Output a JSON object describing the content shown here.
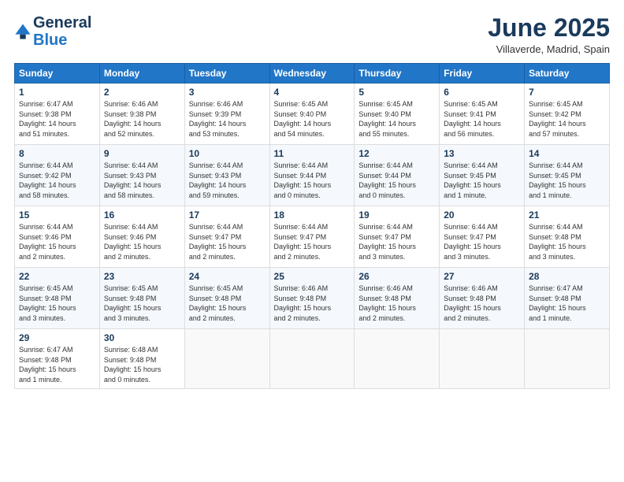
{
  "header": {
    "logo_line1": "General",
    "logo_line2": "Blue",
    "month_title": "June 2025",
    "location": "Villaverde, Madrid, Spain"
  },
  "weekdays": [
    "Sunday",
    "Monday",
    "Tuesday",
    "Wednesday",
    "Thursday",
    "Friday",
    "Saturday"
  ],
  "weeks": [
    [
      {
        "day": "1",
        "lines": [
          "Sunrise: 6:47 AM",
          "Sunset: 9:38 PM",
          "Daylight: 14 hours",
          "and 51 minutes."
        ]
      },
      {
        "day": "2",
        "lines": [
          "Sunrise: 6:46 AM",
          "Sunset: 9:38 PM",
          "Daylight: 14 hours",
          "and 52 minutes."
        ]
      },
      {
        "day": "3",
        "lines": [
          "Sunrise: 6:46 AM",
          "Sunset: 9:39 PM",
          "Daylight: 14 hours",
          "and 53 minutes."
        ]
      },
      {
        "day": "4",
        "lines": [
          "Sunrise: 6:45 AM",
          "Sunset: 9:40 PM",
          "Daylight: 14 hours",
          "and 54 minutes."
        ]
      },
      {
        "day": "5",
        "lines": [
          "Sunrise: 6:45 AM",
          "Sunset: 9:40 PM",
          "Daylight: 14 hours",
          "and 55 minutes."
        ]
      },
      {
        "day": "6",
        "lines": [
          "Sunrise: 6:45 AM",
          "Sunset: 9:41 PM",
          "Daylight: 14 hours",
          "and 56 minutes."
        ]
      },
      {
        "day": "7",
        "lines": [
          "Sunrise: 6:45 AM",
          "Sunset: 9:42 PM",
          "Daylight: 14 hours",
          "and 57 minutes."
        ]
      }
    ],
    [
      {
        "day": "8",
        "lines": [
          "Sunrise: 6:44 AM",
          "Sunset: 9:42 PM",
          "Daylight: 14 hours",
          "and 58 minutes."
        ]
      },
      {
        "day": "9",
        "lines": [
          "Sunrise: 6:44 AM",
          "Sunset: 9:43 PM",
          "Daylight: 14 hours",
          "and 58 minutes."
        ]
      },
      {
        "day": "10",
        "lines": [
          "Sunrise: 6:44 AM",
          "Sunset: 9:43 PM",
          "Daylight: 14 hours",
          "and 59 minutes."
        ]
      },
      {
        "day": "11",
        "lines": [
          "Sunrise: 6:44 AM",
          "Sunset: 9:44 PM",
          "Daylight: 15 hours",
          "and 0 minutes."
        ]
      },
      {
        "day": "12",
        "lines": [
          "Sunrise: 6:44 AM",
          "Sunset: 9:44 PM",
          "Daylight: 15 hours",
          "and 0 minutes."
        ]
      },
      {
        "day": "13",
        "lines": [
          "Sunrise: 6:44 AM",
          "Sunset: 9:45 PM",
          "Daylight: 15 hours",
          "and 1 minute."
        ]
      },
      {
        "day": "14",
        "lines": [
          "Sunrise: 6:44 AM",
          "Sunset: 9:45 PM",
          "Daylight: 15 hours",
          "and 1 minute."
        ]
      }
    ],
    [
      {
        "day": "15",
        "lines": [
          "Sunrise: 6:44 AM",
          "Sunset: 9:46 PM",
          "Daylight: 15 hours",
          "and 2 minutes."
        ]
      },
      {
        "day": "16",
        "lines": [
          "Sunrise: 6:44 AM",
          "Sunset: 9:46 PM",
          "Daylight: 15 hours",
          "and 2 minutes."
        ]
      },
      {
        "day": "17",
        "lines": [
          "Sunrise: 6:44 AM",
          "Sunset: 9:47 PM",
          "Daylight: 15 hours",
          "and 2 minutes."
        ]
      },
      {
        "day": "18",
        "lines": [
          "Sunrise: 6:44 AM",
          "Sunset: 9:47 PM",
          "Daylight: 15 hours",
          "and 2 minutes."
        ]
      },
      {
        "day": "19",
        "lines": [
          "Sunrise: 6:44 AM",
          "Sunset: 9:47 PM",
          "Daylight: 15 hours",
          "and 3 minutes."
        ]
      },
      {
        "day": "20",
        "lines": [
          "Sunrise: 6:44 AM",
          "Sunset: 9:47 PM",
          "Daylight: 15 hours",
          "and 3 minutes."
        ]
      },
      {
        "day": "21",
        "lines": [
          "Sunrise: 6:44 AM",
          "Sunset: 9:48 PM",
          "Daylight: 15 hours",
          "and 3 minutes."
        ]
      }
    ],
    [
      {
        "day": "22",
        "lines": [
          "Sunrise: 6:45 AM",
          "Sunset: 9:48 PM",
          "Daylight: 15 hours",
          "and 3 minutes."
        ]
      },
      {
        "day": "23",
        "lines": [
          "Sunrise: 6:45 AM",
          "Sunset: 9:48 PM",
          "Daylight: 15 hours",
          "and 3 minutes."
        ]
      },
      {
        "day": "24",
        "lines": [
          "Sunrise: 6:45 AM",
          "Sunset: 9:48 PM",
          "Daylight: 15 hours",
          "and 2 minutes."
        ]
      },
      {
        "day": "25",
        "lines": [
          "Sunrise: 6:46 AM",
          "Sunset: 9:48 PM",
          "Daylight: 15 hours",
          "and 2 minutes."
        ]
      },
      {
        "day": "26",
        "lines": [
          "Sunrise: 6:46 AM",
          "Sunset: 9:48 PM",
          "Daylight: 15 hours",
          "and 2 minutes."
        ]
      },
      {
        "day": "27",
        "lines": [
          "Sunrise: 6:46 AM",
          "Sunset: 9:48 PM",
          "Daylight: 15 hours",
          "and 2 minutes."
        ]
      },
      {
        "day": "28",
        "lines": [
          "Sunrise: 6:47 AM",
          "Sunset: 9:48 PM",
          "Daylight: 15 hours",
          "and 1 minute."
        ]
      }
    ],
    [
      {
        "day": "29",
        "lines": [
          "Sunrise: 6:47 AM",
          "Sunset: 9:48 PM",
          "Daylight: 15 hours",
          "and 1 minute."
        ]
      },
      {
        "day": "30",
        "lines": [
          "Sunrise: 6:48 AM",
          "Sunset: 9:48 PM",
          "Daylight: 15 hours",
          "and 0 minutes."
        ]
      },
      {
        "day": "",
        "lines": []
      },
      {
        "day": "",
        "lines": []
      },
      {
        "day": "",
        "lines": []
      },
      {
        "day": "",
        "lines": []
      },
      {
        "day": "",
        "lines": []
      }
    ]
  ]
}
